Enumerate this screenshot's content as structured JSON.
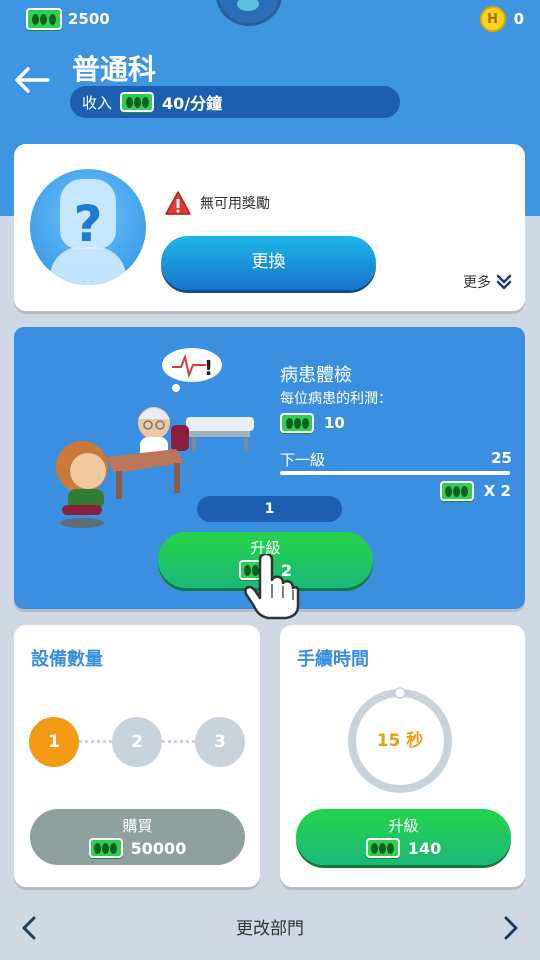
{
  "top_bar": {
    "cash": "2500",
    "coins": "0",
    "coin_letter": "H"
  },
  "header": {
    "title": "普通科",
    "income_label": "收入",
    "income_value": "40/分鐘"
  },
  "manager": {
    "placeholder": "?",
    "no_reward_text": "無可用獎勵",
    "change_label": "更換",
    "more_label": "更多"
  },
  "treatment": {
    "name": "病患體檢",
    "profit_label": "每位病患的利潤：",
    "profit_value": "10",
    "next_level_label": "下一級",
    "next_level_value": "25",
    "multiplier": "X 2",
    "level": "1",
    "upgrade_label": "升級",
    "upgrade_cost": "2"
  },
  "equipment": {
    "title": "設備數量",
    "levels": [
      "1",
      "2",
      "3"
    ],
    "active_level": "1",
    "buy_label": "購買",
    "buy_cost": "50000"
  },
  "procedure_time": {
    "title": "手續時間",
    "time_text": "15 秒",
    "upgrade_label": "升級",
    "upgrade_cost": "140"
  },
  "bottom_nav": {
    "prev": "‹",
    "label": "更改部門",
    "next": "›"
  },
  "colors": {
    "primary_blue": "#3a8fe0",
    "green": "#25d447",
    "orange": "#f49a15",
    "gray_button": "#8fa19e"
  }
}
